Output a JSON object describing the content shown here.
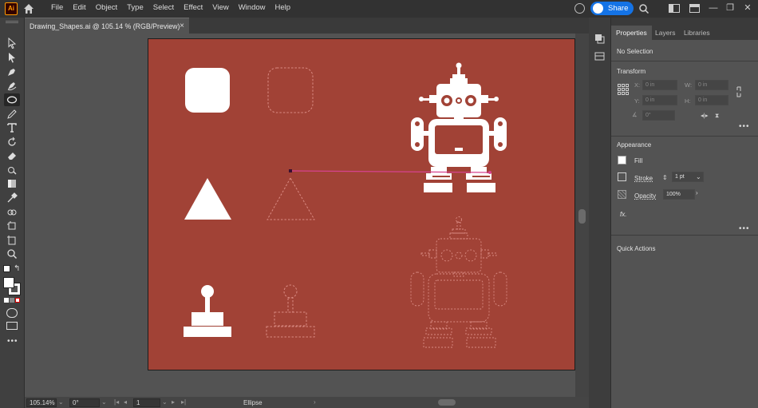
{
  "app": {
    "logo": "Ai",
    "menus": [
      "File",
      "Edit",
      "Object",
      "Type",
      "Select",
      "Effect",
      "View",
      "Window",
      "Help"
    ],
    "share_label": "Share"
  },
  "document": {
    "tab_title": "Drawing_Shapes.ai @ 105.14 % (RGB/Preview)",
    "close_glyph": "×"
  },
  "status": {
    "zoom": "105.14%",
    "rotation": "0°",
    "artboard": "1",
    "tool": "Ellipse"
  },
  "panel": {
    "tabs": [
      "Properties",
      "Layers",
      "Libraries"
    ],
    "selection": "No Selection",
    "transform": {
      "title": "Transform",
      "x_label": "X:",
      "y_label": "Y:",
      "w_label": "W:",
      "h_label": "H:",
      "x": "0 in",
      "y": "0 in",
      "w": "0 in",
      "h": "0 in",
      "angle": "0°"
    },
    "appearance": {
      "title": "Appearance",
      "fill_label": "Fill",
      "stroke_label": "Stroke",
      "stroke_value": "1 pt",
      "opacity_label": "Opacity",
      "opacity_value": "100%",
      "fx_label": "fx."
    },
    "quick_actions": "Quick Actions",
    "more_glyph": "•••"
  },
  "colors": {
    "artboard": "#a14236",
    "accent": "#1473e6",
    "art": "#ffffff",
    "path": "#d6438f"
  },
  "icons": [
    "ai-logo",
    "home-icon",
    "sync-icon",
    "search-icon",
    "workspace-icon",
    "selection-tool-icon",
    "direct-selection-tool-icon",
    "pen-tool-icon",
    "curvature-tool-icon",
    "ellipse-tool-icon",
    "pencil-tool-icon",
    "type-tool-icon",
    "rotate-tool-icon",
    "eraser-tool-icon",
    "scale-tool-icon",
    "gradient-tool-icon",
    "eyedropper-tool-icon",
    "shape-builder-tool-icon",
    "artboard-tool-icon",
    "zoom-tool-icon"
  ]
}
